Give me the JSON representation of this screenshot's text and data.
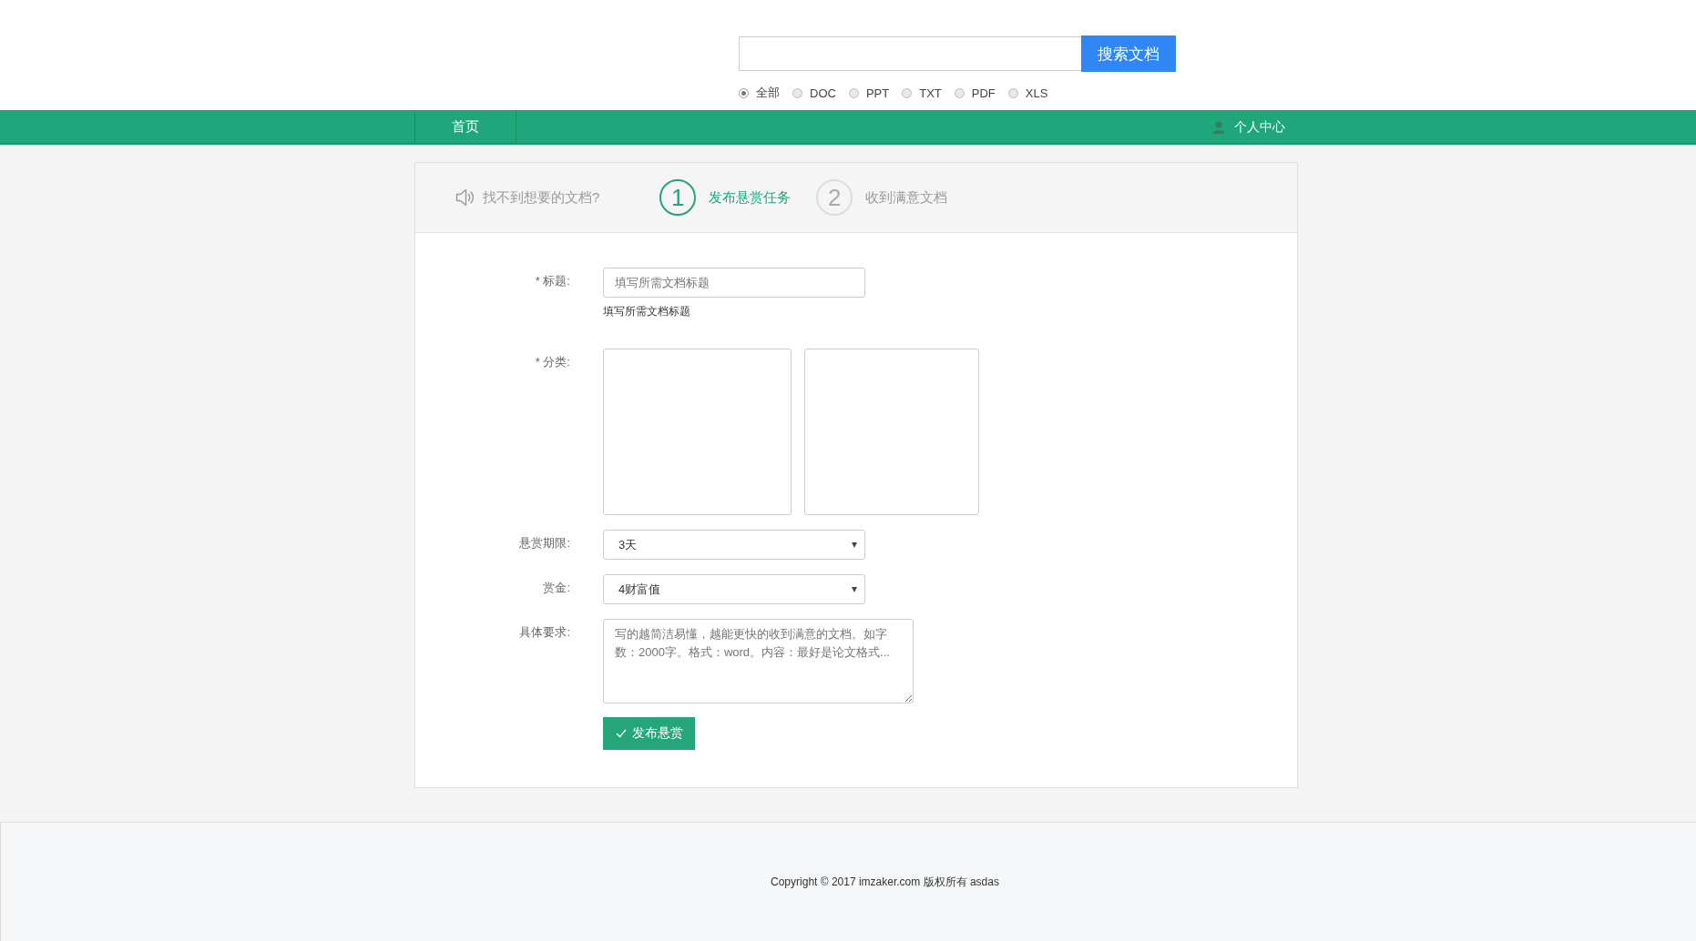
{
  "search": {
    "button": "搜索文档",
    "types": [
      {
        "label": "全部",
        "selected": true
      },
      {
        "label": "DOC",
        "selected": false
      },
      {
        "label": "PPT",
        "selected": false
      },
      {
        "label": "TXT",
        "selected": false
      },
      {
        "label": "PDF",
        "selected": false
      },
      {
        "label": "XLS",
        "selected": false
      }
    ]
  },
  "nav": {
    "items": [
      {
        "label": "首页"
      }
    ],
    "user": "个人中心"
  },
  "steps": {
    "intro": "找不到想要的文档?",
    "items": [
      {
        "number": "1",
        "label": "发布悬赏任务",
        "selected": true
      },
      {
        "number": "2",
        "label": "收到满意文档",
        "selected": false
      }
    ]
  },
  "form": {
    "fields": [
      {
        "kind": "text",
        "label": "* 标题:",
        "placeholder": "填写所需文档标题",
        "hint": "填写所需文档标题"
      },
      {
        "kind": "category",
        "label": "* 分类:"
      },
      {
        "kind": "select",
        "label": "悬赏期限:",
        "value": "3天"
      },
      {
        "kind": "select",
        "label": "赏金:",
        "value": "4财富值"
      },
      {
        "kind": "textarea",
        "label": "具体要求:",
        "placeholder": "写的越简洁易懂，越能更快的收到满意的文档。如字数：2000字。格式：word。内容：最好是论文格式..."
      }
    ],
    "submit": "发布悬赏"
  },
  "footer": "Copyright © 2017 imzaker.com 版权所有 asdas"
}
